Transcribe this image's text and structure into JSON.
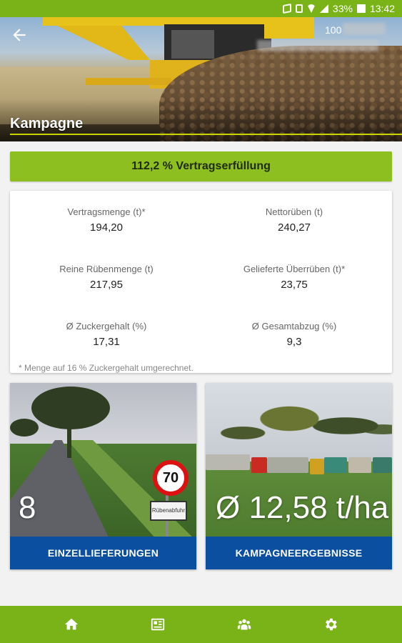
{
  "statusbar": {
    "battery": "33%",
    "time": "13:42"
  },
  "header": {
    "title": "Kampagne",
    "account_id": "100"
  },
  "fulfillment": {
    "label": "112,2 % Vertragserfüllung"
  },
  "stats": [
    {
      "label": "Vertragsmenge (t)*",
      "value": "194,20"
    },
    {
      "label": "Nettorüben (t)",
      "value": "240,27"
    },
    {
      "label": "Reine Rübenmenge (t)",
      "value": "217,95"
    },
    {
      "label": "Gelieferte Überrüben (t)*",
      "value": "23,75"
    },
    {
      "label": "Ø Zuckergehalt (%)",
      "value": "17,31"
    },
    {
      "label": "Ø Gesamtabzug (%)",
      "value": "9,3"
    }
  ],
  "footnote": "* Menge auf 16 % Zuckergehalt umgerechnet.",
  "cards": [
    {
      "big": "8",
      "button": "EINZELLIEFERUNGEN",
      "sign": "70",
      "plate": "Rübenabfuhr"
    },
    {
      "big": "Ø 12,58 t/ha",
      "button": "KAMPAGNEERGEBNISSE"
    }
  ],
  "nav": [
    "home-icon",
    "news-icon",
    "group-icon",
    "settings-icon"
  ],
  "colors": {
    "green": "#7ab317",
    "fulfill_green": "#8cbf1f",
    "button_blue": "#0b4fa1"
  }
}
